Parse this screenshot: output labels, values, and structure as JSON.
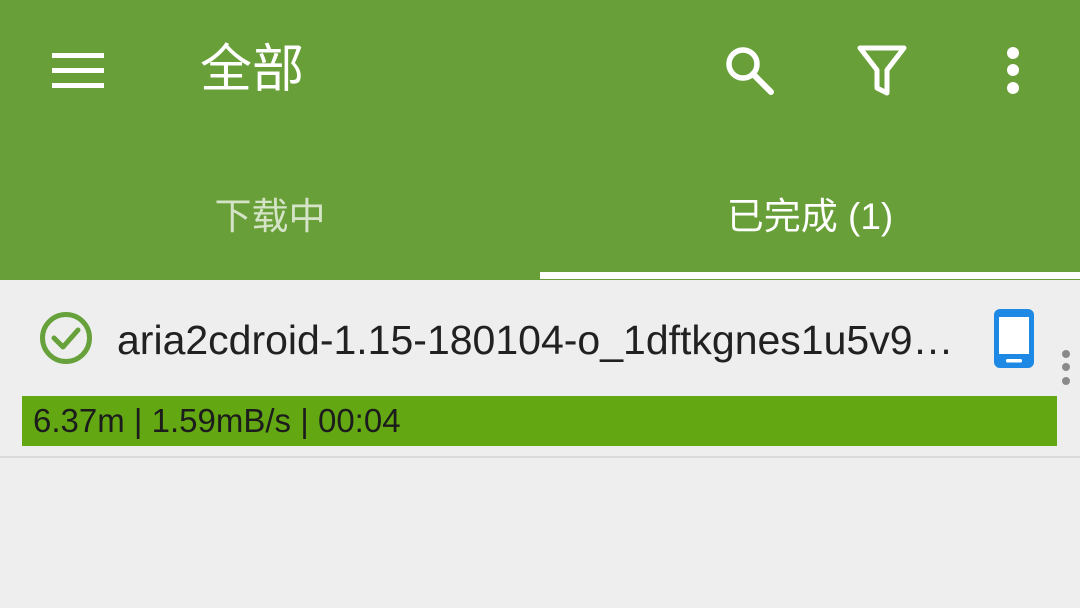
{
  "app_bar": {
    "title": "全部",
    "menu_icon": "menu-icon",
    "action_icons": [
      "search-icon",
      "filter-icon",
      "more-vert-icon"
    ]
  },
  "tabs": [
    {
      "label": "下载中",
      "selected": false
    },
    {
      "label": "已完成 (1)",
      "selected": true
    }
  ],
  "downloads": [
    {
      "status_icon": "check-circle-icon",
      "filename": "aria2cdroid-1.15-180104-o_1dftkgnes1u5v9…",
      "storage_icon": "phone-icon",
      "more_icon": "more-vert-icon",
      "stats": {
        "size": "6.37m",
        "speed": "1.59mB/s",
        "elapsed": "00:04",
        "separator": " | "
      },
      "progress": 1.0
    }
  ],
  "colors": {
    "primary": "#689f38",
    "progress": "#63a812",
    "check": "#67a13b",
    "storage": "#1e88e5",
    "background": "#eeeeee",
    "text": "#212121"
  }
}
